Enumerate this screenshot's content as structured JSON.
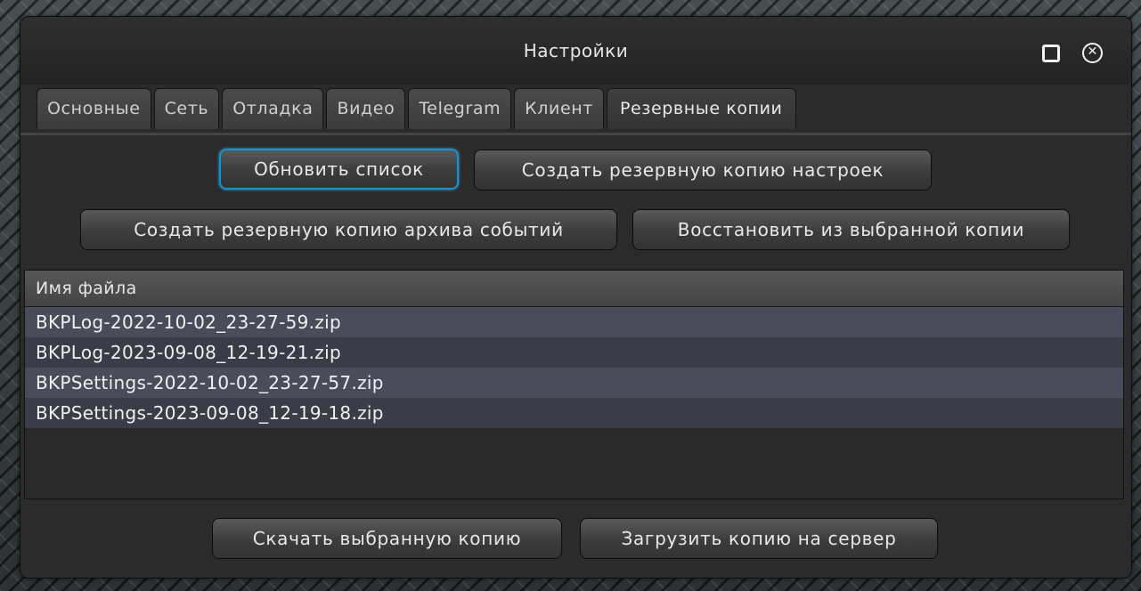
{
  "window": {
    "title": "Настройки"
  },
  "tabs": [
    {
      "label": "Основные"
    },
    {
      "label": "Сеть"
    },
    {
      "label": "Отладка"
    },
    {
      "label": "Видео"
    },
    {
      "label": "Telegram"
    },
    {
      "label": "Клиент"
    },
    {
      "label": "Резервные копии",
      "active": true
    }
  ],
  "buttons": {
    "refresh": "Обновить список",
    "backup_settings": "Создать резервную копию настроек",
    "backup_events": "Создать резервную копию архива событий",
    "restore": "Восстановить из выбранной копии",
    "download": "Скачать выбранную копию",
    "upload": "Загрузить копию на сервер"
  },
  "table": {
    "header": "Имя файла",
    "rows": [
      "BKPLog-2022-10-02_23-27-59.zip",
      "BKPLog-2023-09-08_12-19-21.zip",
      "BKPSettings-2022-10-02_23-27-57.zip",
      "BKPSettings-2023-09-08_12-19-18.zip"
    ]
  },
  "icons": {
    "maximize": "maximize-icon",
    "close": "close-circle-icon"
  },
  "colors": {
    "focus_accent": "#1e90c8"
  }
}
